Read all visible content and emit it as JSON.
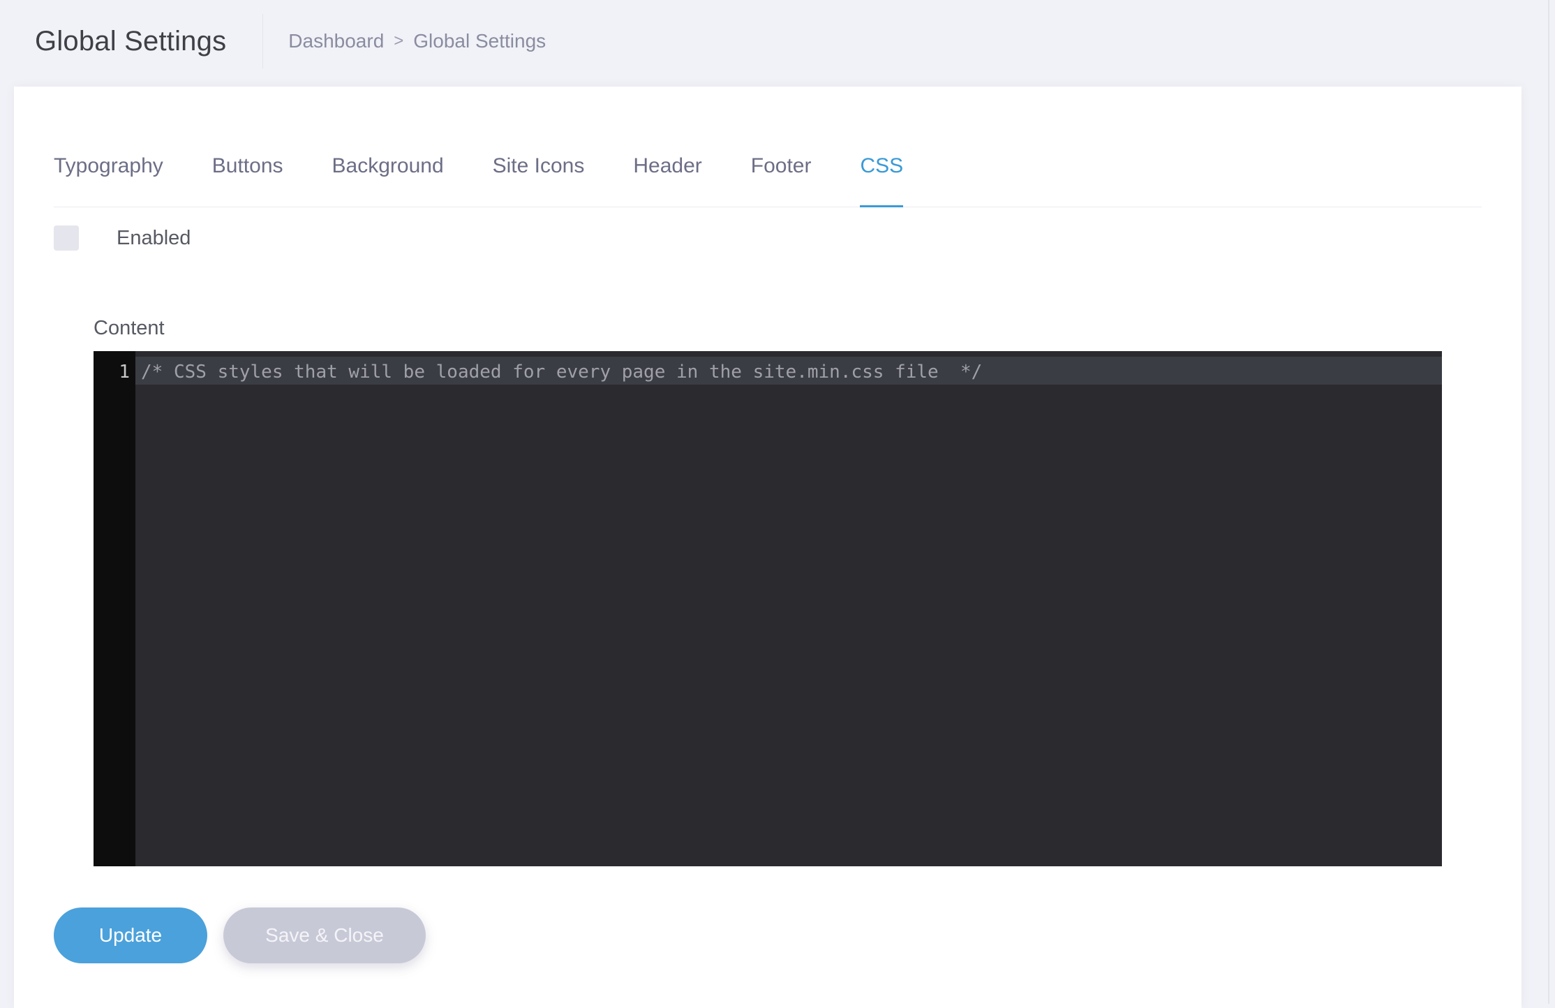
{
  "header": {
    "title": "Global Settings",
    "breadcrumb": [
      {
        "label": "Dashboard"
      },
      {
        "label": "Global Settings"
      }
    ],
    "breadcrumb_separator": ">"
  },
  "tabs": [
    {
      "label": "Typography",
      "active": false
    },
    {
      "label": "Buttons",
      "active": false
    },
    {
      "label": "Background",
      "active": false
    },
    {
      "label": "Site Icons",
      "active": false
    },
    {
      "label": "Header",
      "active": false
    },
    {
      "label": "Footer",
      "active": false
    },
    {
      "label": "CSS",
      "active": true
    }
  ],
  "enabled": {
    "label": "Enabled",
    "checked": false
  },
  "content": {
    "label": "Content",
    "line_numbers": [
      "1"
    ],
    "lines": [
      "/* CSS styles that will be loaded for every page in the site.min.css file  */"
    ]
  },
  "actions": {
    "update_label": "Update",
    "save_close_label": "Save & Close"
  },
  "colors": {
    "accent": "#3a9ad6",
    "update_button": "#4ba1db",
    "save_button": "#c8c9d7",
    "editor_bg": "#2a2a2f",
    "gutter_bg": "#0d0d0d"
  },
  "icons": {
    "breadcrumb_separator": "chevron-right-icon"
  }
}
